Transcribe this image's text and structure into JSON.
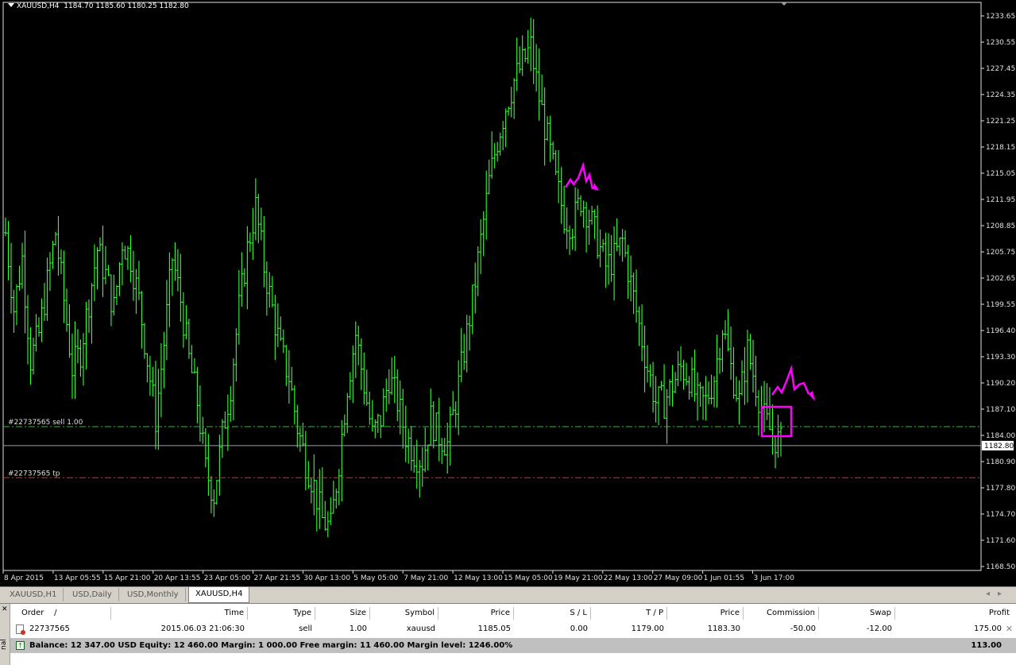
{
  "chart": {
    "title": "XAUUSD,H4",
    "ohlc": "1184.70 1185.60 1180.25 1182.80",
    "current_price": "1182.80",
    "price_axis_labels": [
      "1233.65",
      "1230.55",
      "1227.45",
      "1224.35",
      "1221.25",
      "1218.15",
      "1215.05",
      "1211.95",
      "1208.85",
      "1205.75",
      "1202.65",
      "1199.55",
      "1196.40",
      "1193.30",
      "1190.20",
      "1187.10",
      "1184.00",
      "1180.90",
      "1177.80",
      "1174.70",
      "1171.60",
      "1168.50"
    ],
    "time_axis_labels": [
      "8 Apr 2015",
      "13 Apr 05:55",
      "15 Apr 21:00",
      "20 Apr 13:55",
      "23 Apr 05:00",
      "27 Apr 21:55",
      "30 Apr 13:00",
      "5 May 05:00",
      "7 May 21:00",
      "12 May 13:00",
      "15 May 05:00",
      "19 May 21:00",
      "22 May 13:00",
      "27 May 09:00",
      "1 Jun 01:55",
      "3 Jun 17:00"
    ],
    "sell_line_label": "#22737565 sell 1.00",
    "tp_line_label": "#22737565 tp",
    "sell_price": 1185.05,
    "tp_price": 1179.0,
    "colors": {
      "background": "#000000",
      "bars": "#33ff33",
      "sell_line": "#33bb33",
      "tp_line": "#ff2020",
      "bid_line": "#9aa0a6",
      "annotation": "#ff00ff"
    },
    "price_path": [
      1208,
      1199,
      1205,
      1193,
      1196,
      1202,
      1208,
      1200,
      1192,
      1194,
      1200,
      1206,
      1203,
      1199,
      1207,
      1205,
      1200,
      1193,
      1186,
      1195,
      1205,
      1200,
      1193,
      1188,
      1180,
      1177,
      1184,
      1190,
      1199,
      1206,
      1211,
      1204,
      1199,
      1194,
      1191,
      1185,
      1181,
      1178,
      1174,
      1173,
      1181,
      1190,
      1196,
      1190,
      1184,
      1186,
      1191,
      1188,
      1184,
      1182,
      1181,
      1186,
      1184,
      1183,
      1188,
      1194,
      1200,
      1207,
      1214,
      1219,
      1223,
      1226,
      1228,
      1230,
      1224,
      1219,
      1214,
      1210,
      1209,
      1212,
      1210,
      1207,
      1204,
      1205,
      1207,
      1202,
      1197,
      1192,
      1188,
      1188,
      1190,
      1192,
      1191,
      1188,
      1188,
      1191,
      1197,
      1192,
      1188,
      1194,
      1190,
      1186,
      1184,
      1183
    ]
  },
  "tabs": [
    {
      "label": "XAUUSD,H1"
    },
    {
      "label": "USD,Daily"
    },
    {
      "label": "USD,Monthly"
    },
    {
      "label": "XAUUSD,H4"
    }
  ],
  "terminal": {
    "side_label": "nal",
    "columns": [
      "Order",
      "/",
      "Time",
      "Type",
      "Size",
      "Symbol",
      "Price",
      "S / L",
      "T / P",
      "Price",
      "Commission",
      "Swap",
      "Profit"
    ],
    "row": {
      "order": "22737565",
      "time": "2015.06.03 21:06:30",
      "type": "sell",
      "size": "1.00",
      "symbol": "xauusd",
      "price": "1185.05",
      "sl": "0.00",
      "tp": "1179.00",
      "cur_price": "1183.30",
      "commission": "-50.00",
      "swap": "-12.00",
      "profit": "175.00"
    },
    "balance_text": "Balance: 12 347.00 USD  Equity: 12 460.00  Margin: 1 000.00  Free margin: 11 460.00  Margin level: 1246.00%",
    "balance_profit": "113.00"
  }
}
